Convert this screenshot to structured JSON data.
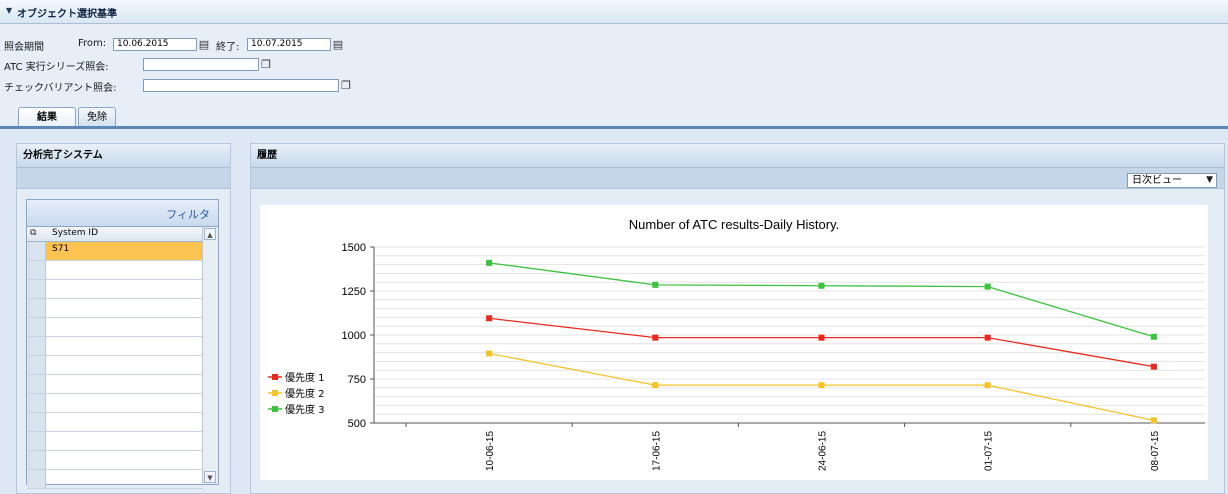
{
  "criteria_section": {
    "title": "オブジェクト選択基準"
  },
  "criteria": {
    "period_label": "照会期間",
    "from_label": "From:",
    "from_value": "10.06.2015",
    "to_label": "終了:",
    "to_value": "10.07.2015",
    "series_label": "ATC 実行シリーズ照会:",
    "series_value": "",
    "variant_label": "チェックバリアント照会:",
    "variant_value": ""
  },
  "tabs": [
    {
      "label": "結果",
      "active": true
    },
    {
      "label": "免除",
      "active": false
    }
  ],
  "left_panel": {
    "title": "分析完了システム",
    "filter_label": "フィルタ",
    "column_header": "System ID",
    "rows": [
      "S71",
      "",
      "",
      "",
      "",
      "",
      "",
      "",
      "",
      "",
      "",
      "",
      ""
    ]
  },
  "right_panel": {
    "title": "履歴",
    "view_select": "日次ビュー"
  },
  "colors": {
    "p1": "#e8291c",
    "p2": "#f5c228",
    "p3": "#3cc23c"
  },
  "chart_data": {
    "type": "line",
    "title": "Number of ATC results-Daily History.",
    "x": [
      "10-06-15",
      "17-06-15",
      "24-06-15",
      "01-07-15",
      "08-07-15"
    ],
    "ylim": [
      500,
      1500
    ],
    "yticks": [
      "500",
      "750",
      "1000",
      "1250",
      "1500"
    ],
    "legend_position": "left",
    "series": [
      {
        "name": "優先度 1",
        "color": "#e8291c",
        "values": [
          1095,
          985,
          985,
          985,
          820
        ]
      },
      {
        "name": "優先度 2",
        "color": "#f5c228",
        "values": [
          895,
          715,
          715,
          715,
          515
        ]
      },
      {
        "name": "優先度 3",
        "color": "#3cc23c",
        "values": [
          1410,
          1285,
          1280,
          1275,
          990
        ]
      }
    ]
  }
}
